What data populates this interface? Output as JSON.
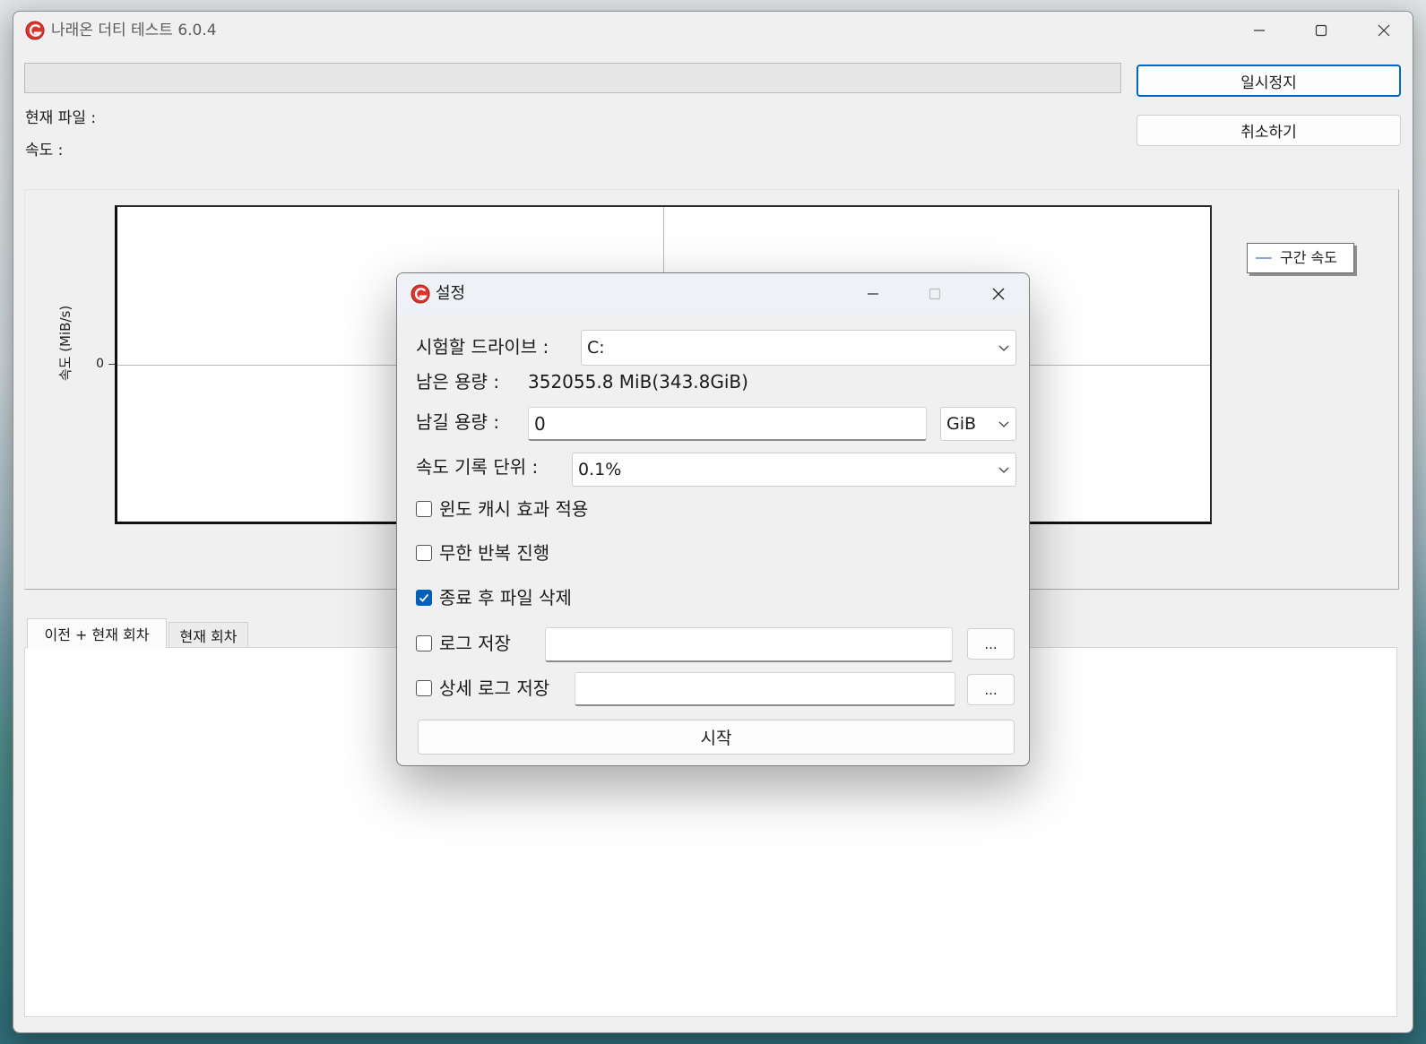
{
  "window": {
    "title": "나래온 더티 테스트 6.0.4"
  },
  "icons": {
    "app": "app-logo-icon",
    "minimize": "minimize-icon",
    "maximize": "maximize-icon",
    "close": "close-icon",
    "dropdown": "chevron-down-icon",
    "checkbox_checked": "checkmark-icon"
  },
  "progress": {
    "fraction": 0
  },
  "actions": {
    "pause_label": "일시정지",
    "cancel_label": "취소하기"
  },
  "status": {
    "current_file_label": "현재 파일 :",
    "speed_label": "속도 :"
  },
  "chart": {
    "type": "line",
    "ylabel": "속도 (MiB/s)",
    "y_ticks": [
      "0"
    ],
    "grid": true,
    "legend_placement": "top-right",
    "series": [
      {
        "name": "구간 속도",
        "values": []
      }
    ]
  },
  "tabs": [
    {
      "label": "이전 + 현재 회차",
      "active": true
    },
    {
      "label": "현재 회차",
      "active": false
    }
  ],
  "dialog": {
    "title": "설정",
    "drive": {
      "label": "시험할 드라이브 :",
      "value": "C:"
    },
    "free_space": {
      "label": "남은 용량 :",
      "value": "352055.8 MiB(343.8GiB)"
    },
    "reserve": {
      "label": "남길 용량 :",
      "value": "0",
      "unit": "GiB"
    },
    "speed_unit": {
      "label": "속도 기록 단위 :",
      "value": "0.1%"
    },
    "options": [
      {
        "label": "윈도 캐시 효과 적용",
        "checked": false
      },
      {
        "label": "무한 반복 진행",
        "checked": false
      },
      {
        "label": "종료 후 파일 삭제",
        "checked": true
      }
    ],
    "log": {
      "label": "로그 저장",
      "checked": false,
      "browse_label": "..."
    },
    "detail_log": {
      "label": "상세 로그 저장",
      "checked": false,
      "browse_label": "..."
    },
    "start_label": "시작"
  },
  "colors": {
    "accent": "#0067c0",
    "checkbox_checked": "#005fb8",
    "legend_line": "#8aa8d6",
    "app_icon": "#d9352a"
  }
}
